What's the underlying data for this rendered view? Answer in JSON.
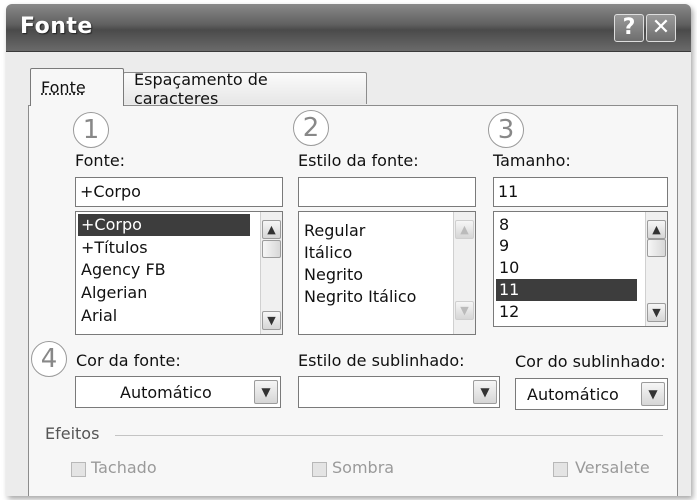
{
  "window": {
    "title": "Fonte",
    "help_glyph": "?",
    "close_glyph": "✕"
  },
  "tabs": [
    {
      "label": "Fonte",
      "active": true
    },
    {
      "label": "Espaçamento de caracteres",
      "active": false
    }
  ],
  "callouts": [
    "1",
    "2",
    "3",
    "4"
  ],
  "font": {
    "label": "Fonte:",
    "value": "+Corpo",
    "items": [
      "+Corpo",
      "+Títulos",
      "Agency FB",
      "Algerian",
      "Arial"
    ],
    "selected": "+Corpo"
  },
  "style": {
    "label": "Estilo da fonte:",
    "value": "",
    "items": [
      "Regular",
      "Itálico",
      "Negrito",
      "Negrito Itálico"
    ]
  },
  "size": {
    "label": "Tamanho:",
    "value": "11",
    "items": [
      "8",
      "9",
      "10",
      "11",
      "12"
    ],
    "selected": "11"
  },
  "font_color": {
    "label": "Cor da fonte:",
    "value": "Automático"
  },
  "underline_style": {
    "label": "Estilo de sublinhado:",
    "value": ""
  },
  "underline_color": {
    "label": "Cor do sublinhado:",
    "value": "Automático"
  },
  "effects": {
    "label": "Efeitos",
    "checkboxes": [
      "Tachado",
      "Sombra",
      "Versalete"
    ]
  },
  "icons": {
    "scroll_up": "▲",
    "scroll_down": "▼",
    "dropdown": "▼"
  },
  "colors": {
    "selection": "#3d3d3d",
    "titlebar": "#5e5e5e"
  }
}
